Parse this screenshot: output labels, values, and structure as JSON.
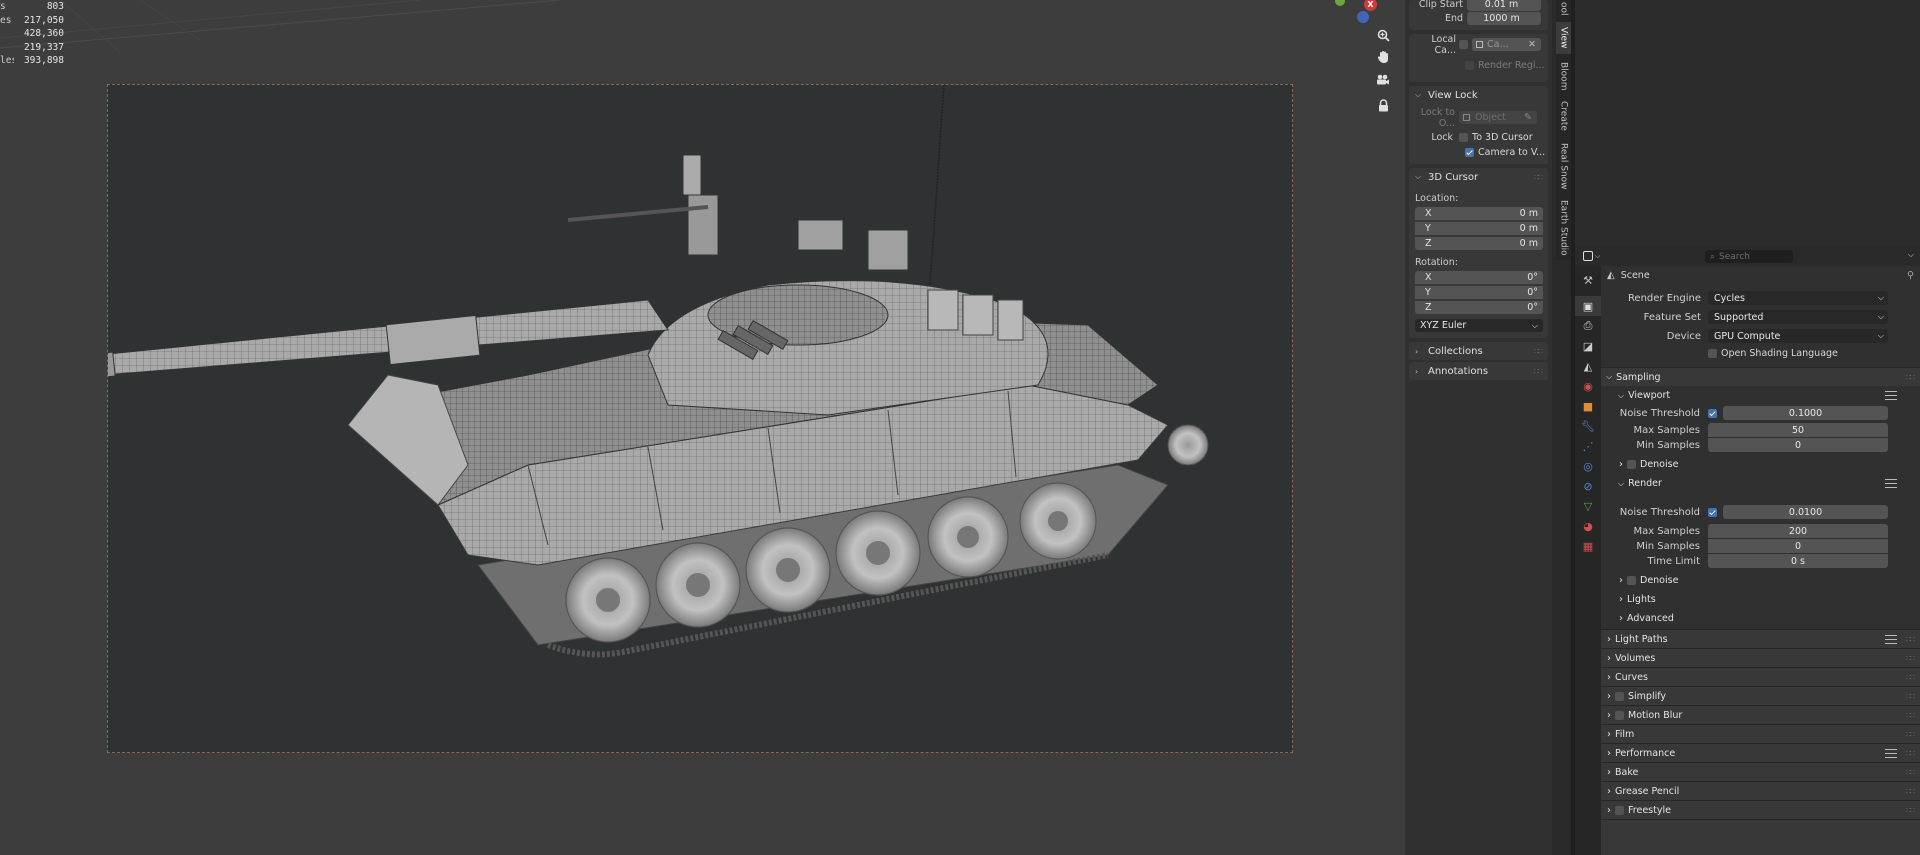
{
  "stats": [
    {
      "label": "s",
      "value": "803"
    },
    {
      "label": "es",
      "value": "217,050"
    },
    {
      "label": "",
      "value": "428,360"
    },
    {
      "label": "",
      "value": "219,337"
    },
    {
      "label": "les",
      "value": "393,898"
    }
  ],
  "gizmo": {
    "x_label": "X"
  },
  "npanel": {
    "clip_start_label": "Clip Start",
    "clip_start_value": "0.01 m",
    "end_label": "End",
    "end_value": "1000 m",
    "local_camera_label": "Local Ca...",
    "local_camera_value": "Ca...",
    "render_region_label": "Render Regi...",
    "view_lock_label": "View Lock",
    "lock_to_object_label": "Lock to O...",
    "lock_to_object_placeholder": "Object",
    "lock_label": "Lock",
    "to_3d_cursor_label": "To 3D Cursor",
    "camera_to_view_label": "Camera to V...",
    "cursor_header": "3D Cursor",
    "location_label": "Location:",
    "loc": [
      {
        "axis": "X",
        "value": "0 m"
      },
      {
        "axis": "Y",
        "value": "0 m"
      },
      {
        "axis": "Z",
        "value": "0 m"
      }
    ],
    "rotation_label": "Rotation:",
    "rot": [
      {
        "axis": "X",
        "value": "0°"
      },
      {
        "axis": "Y",
        "value": "0°"
      },
      {
        "axis": "Z",
        "value": "0°"
      }
    ],
    "rotation_mode": "XYZ Euler",
    "collections_label": "Collections",
    "annotations_label": "Annotations"
  },
  "vtabs": [
    "ool",
    "View",
    "Bloom",
    "Create",
    "Real Snow",
    "Earth Studio"
  ],
  "props": {
    "search_placeholder": "Search",
    "breadcrumb": "Scene",
    "render_engine_label": "Render Engine",
    "render_engine_value": "Cycles",
    "feature_set_label": "Feature Set",
    "feature_set_value": "Supported",
    "device_label": "Device",
    "device_value": "GPU Compute",
    "osl_label": "Open Shading Language",
    "sampling_label": "Sampling",
    "viewport_label": "Viewport",
    "vp_noise_label": "Noise Threshold",
    "vp_noise_value": "0.1000",
    "vp_max_label": "Max Samples",
    "vp_max_value": "50",
    "vp_min_label": "Min Samples",
    "vp_min_value": "0",
    "vp_denoise_label": "Denoise",
    "render_label": "Render",
    "r_noise_label": "Noise Threshold",
    "r_noise_value": "0.0100",
    "r_max_label": "Max Samples",
    "r_max_value": "200",
    "r_min_label": "Min Samples",
    "r_min_value": "0",
    "r_time_label": "Time Limit",
    "r_time_value": "0 s",
    "r_denoise_label": "Denoise",
    "lights_label": "Lights",
    "advanced_label": "Advanced",
    "light_paths_label": "Light Paths",
    "volumes_label": "Volumes",
    "curves_label": "Curves",
    "simplify_label": "Simplify",
    "motion_blur_label": "Motion Blur",
    "film_label": "Film",
    "performance_label": "Performance",
    "bake_label": "Bake",
    "grease_pencil_label": "Grease Pencil",
    "freestyle_label": "Freestyle"
  },
  "colors": {
    "accent": "#4772b3",
    "frame_border": "#8a6b52",
    "axis_x": "#d03a3a",
    "axis_y": "#6ea33f",
    "axis_z": "#3d68b8"
  }
}
